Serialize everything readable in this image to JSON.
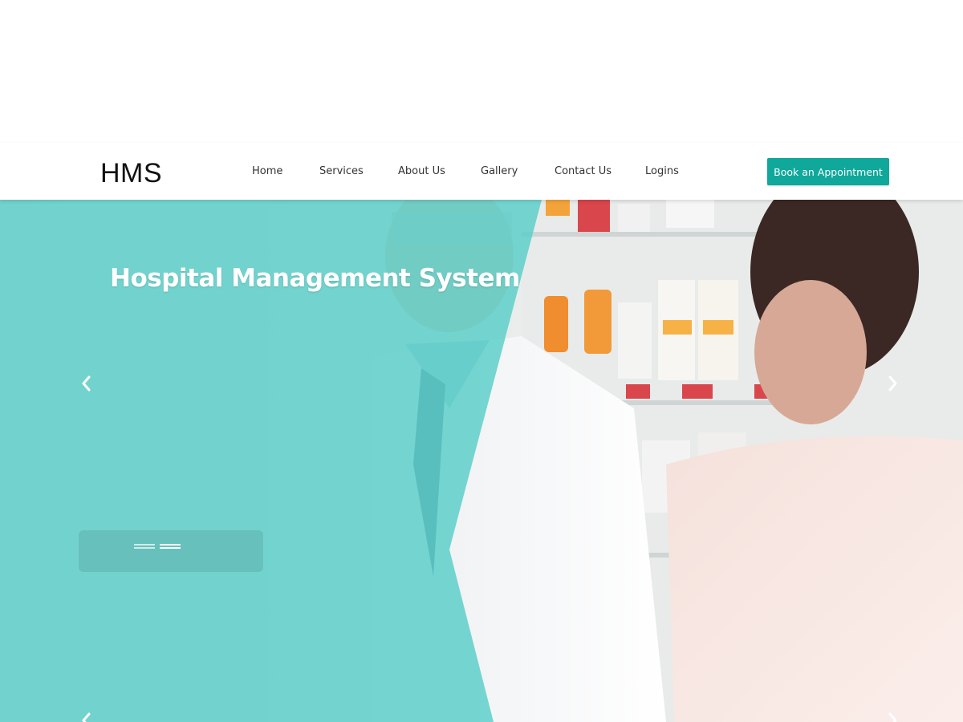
{
  "header": {
    "logo_text": "HMS",
    "nav": {
      "home": "Home",
      "services": "Services",
      "about": "About Us",
      "gallery": "Gallery",
      "contact": "Contact Us",
      "logins": "Logins"
    },
    "cta_label": "Book an Appointment"
  },
  "hero": {
    "title": "Hospital Management System",
    "slide_indicators": 2,
    "active_slide": 2
  },
  "colors": {
    "accent": "#0fa89b",
    "overlay_teal": "#5fcfca",
    "nav_text": "#333333",
    "logo_text": "#111111"
  },
  "icons": {
    "prev": "chevron-left-icon",
    "next": "chevron-right-icon"
  }
}
